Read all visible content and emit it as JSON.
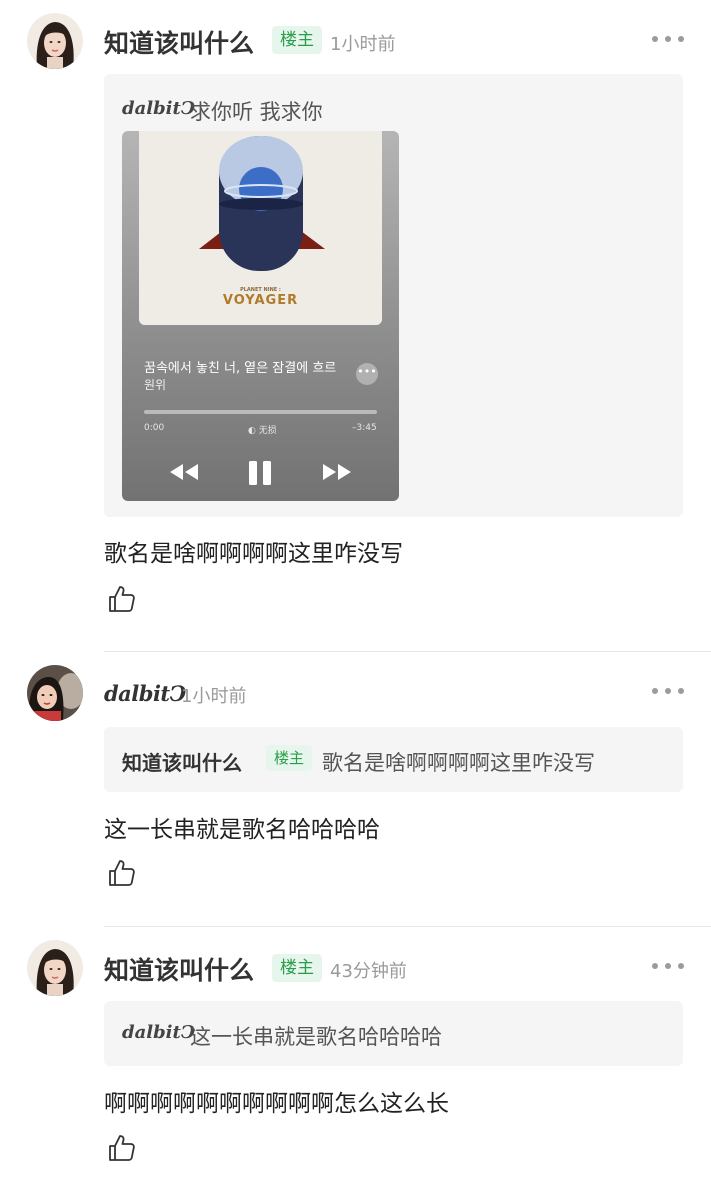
{
  "comments": [
    {
      "author": "知道该叫什么",
      "badge": "楼主",
      "time": "1小时前",
      "quote_author": "dalbitↃ",
      "quote_text": "求你听 我求你",
      "music": {
        "album_small": "PLANET NINE :",
        "album": "VOYAGER",
        "song": "꿈속에서 놓친 너, 옅은 잠결에 흐르",
        "artist": "원위",
        "time_elapsed": "0:00",
        "audio_label": "无损",
        "time_remaining": "–3:45",
        "progress": 0
      },
      "text": "歌名是啥啊啊啊啊这里咋没写"
    },
    {
      "author": "dalbitↃ",
      "time": "1小时前",
      "quote_author": "知道该叫什么",
      "quote_badge": "楼主",
      "quote_text": "歌名是啥啊啊啊啊这里咋没写",
      "text": "这一长串就是歌名哈哈哈哈"
    },
    {
      "author": "知道该叫什么",
      "badge": "楼主",
      "time": "43分钟前",
      "quote_author": "dalbitↃ",
      "quote_text": "这一长串就是歌名哈哈哈哈",
      "text": "啊啊啊啊啊啊啊啊啊啊怎么这么长"
    }
  ],
  "colors": {
    "badge_bg": "#e7f6ec",
    "badge_text": "#2a9d4b",
    "quote_bg": "#f5f5f5",
    "meta": "#9a9a9a"
  },
  "icons": {
    "more": "more-dots-icon",
    "like": "thumbs-up-icon"
  }
}
